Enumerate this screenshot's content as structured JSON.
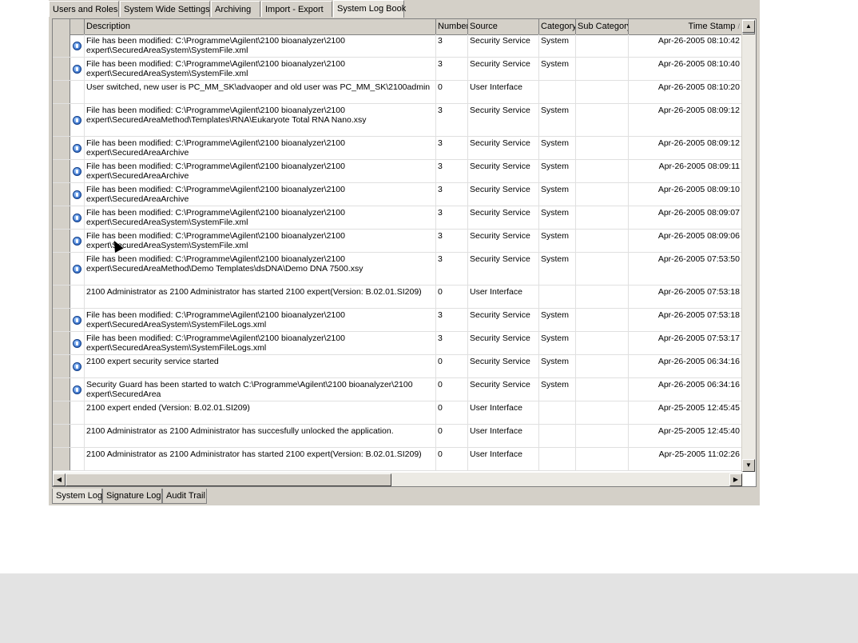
{
  "top_tabs": [
    "Users and Roles",
    "System Wide Settings",
    "Archiving",
    "Import - Export",
    "System Log Book"
  ],
  "active_top_tab": "System Log Book",
  "columns": {
    "description": "Description",
    "number": "Number",
    "source": "Source",
    "category": "Category",
    "sub_category": "Sub Category",
    "time_stamp": "Time Stamp",
    "sort_indicator": "/"
  },
  "rows": [
    {
      "desc": "File has been modified: C:\\Programme\\Agilent\\2100 bioanalyzer\\2100\nexpert\\SecuredAreaSystem\\SystemFile.xml",
      "num": "3",
      "src": "Security Service",
      "cat": "System",
      "sub": "",
      "ts": "Apr-26-2005 08:10:42",
      "icon": true
    },
    {
      "desc": "File has been modified: C:\\Programme\\Agilent\\2100 bioanalyzer\\2100\nexpert\\SecuredAreaSystem\\SystemFile.xml",
      "num": "3",
      "src": "Security Service",
      "cat": "System",
      "sub": "",
      "ts": "Apr-26-2005 08:10:40",
      "icon": true
    },
    {
      "desc": "User switched, new user is PC_MM_SK\\advaoper and old user was PC_MM_SK\\2100admin",
      "num": "0",
      "src": "User Interface",
      "cat": "",
      "sub": "",
      "ts": "Apr-26-2005 08:10:20",
      "icon": false
    },
    {
      "desc": "File has been modified: C:\\Programme\\Agilent\\2100 bioanalyzer\\2100\nexpert\\SecuredAreaMethod\\Templates\\RNA\\Eukaryote Total RNA Nano.xsy",
      "num": "3",
      "src": "Security Service",
      "cat": "System",
      "sub": "",
      "ts": "Apr-26-2005 08:09:12",
      "icon": true
    },
    {
      "desc": "File has been modified: C:\\Programme\\Agilent\\2100 bioanalyzer\\2100\nexpert\\SecuredAreaArchive",
      "num": "3",
      "src": "Security Service",
      "cat": "System",
      "sub": "",
      "ts": "Apr-26-2005 08:09:12",
      "icon": true
    },
    {
      "desc": "File has been modified: C:\\Programme\\Agilent\\2100 bioanalyzer\\2100\nexpert\\SecuredAreaArchive",
      "num": "3",
      "src": "Security Service",
      "cat": "System",
      "sub": "",
      "ts": "Apr-26-2005 08:09:11",
      "icon": true
    },
    {
      "desc": "File has been modified: C:\\Programme\\Agilent\\2100 bioanalyzer\\2100\nexpert\\SecuredAreaArchive",
      "num": "3",
      "src": "Security Service",
      "cat": "System",
      "sub": "",
      "ts": "Apr-26-2005 08:09:10",
      "icon": true
    },
    {
      "desc": "File has been modified: C:\\Programme\\Agilent\\2100 bioanalyzer\\2100\nexpert\\SecuredAreaSystem\\SystemFile.xml",
      "num": "3",
      "src": "Security Service",
      "cat": "System",
      "sub": "",
      "ts": "Apr-26-2005 08:09:07",
      "icon": true
    },
    {
      "desc": "File has been modified: C:\\Programme\\Agilent\\2100 bioanalyzer\\2100\nexpert\\SecuredAreaSystem\\SystemFile.xml",
      "num": "3",
      "src": "Security Service",
      "cat": "System",
      "sub": "",
      "ts": "Apr-26-2005 08:09:06",
      "icon": true
    },
    {
      "desc": "File has been modified: C:\\Programme\\Agilent\\2100 bioanalyzer\\2100\nexpert\\SecuredAreaMethod\\Demo Templates\\dsDNA\\Demo DNA 7500.xsy",
      "num": "3",
      "src": "Security Service",
      "cat": "System",
      "sub": "",
      "ts": "Apr-26-2005 07:53:50",
      "icon": true
    },
    {
      "desc": "2100 Administrator as 2100 Administrator has started 2100 expert(Version: B.02.01.SI209)",
      "num": "0",
      "src": "User Interface",
      "cat": "",
      "sub": "",
      "ts": "Apr-26-2005 07:53:18",
      "icon": false
    },
    {
      "desc": "File has been modified: C:\\Programme\\Agilent\\2100 bioanalyzer\\2100\nexpert\\SecuredAreaSystem\\SystemFileLogs.xml",
      "num": "3",
      "src": "Security Service",
      "cat": "System",
      "sub": "",
      "ts": "Apr-26-2005 07:53:18",
      "icon": true
    },
    {
      "desc": "File has been modified: C:\\Programme\\Agilent\\2100 bioanalyzer\\2100\nexpert\\SecuredAreaSystem\\SystemFileLogs.xml",
      "num": "3",
      "src": "Security Service",
      "cat": "System",
      "sub": "",
      "ts": "Apr-26-2005 07:53:17",
      "icon": true
    },
    {
      "desc": "2100 expert security service started",
      "num": "0",
      "src": "Security Service",
      "cat": "System",
      "sub": "",
      "ts": "Apr-26-2005 06:34:16",
      "icon": true
    },
    {
      "desc": "Security Guard has been started to watch C:\\Programme\\Agilent\\2100 bioanalyzer\\2100\nexpert\\SecuredArea",
      "num": "0",
      "src": "Security Service",
      "cat": "System",
      "sub": "",
      "ts": "Apr-26-2005 06:34:16",
      "icon": true
    },
    {
      "desc": "2100 expert ended (Version: B.02.01.SI209)",
      "num": "0",
      "src": "User Interface",
      "cat": "",
      "sub": "",
      "ts": "Apr-25-2005 12:45:45",
      "icon": false
    },
    {
      "desc": "2100 Administrator as 2100 Administrator has succesfully unlocked the application.",
      "num": "0",
      "src": "User Interface",
      "cat": "",
      "sub": "",
      "ts": "Apr-25-2005 12:45:40",
      "icon": false
    },
    {
      "desc": "2100 Administrator as 2100 Administrator has started 2100 expert(Version: B.02.01.SI209)",
      "num": "0",
      "src": "User Interface",
      "cat": "",
      "sub": "",
      "ts": "Apr-25-2005 11:02:26",
      "icon": false
    }
  ],
  "bottom_tabs": [
    "System Log",
    "Signature Log",
    "Audit Trail"
  ],
  "active_bottom_tab": "System Log",
  "icons": {
    "info": "info-icon",
    "scroll_up": "scroll-up-icon",
    "scroll_down": "scroll-down-icon",
    "scroll_left": "scroll-left-icon",
    "scroll_right": "scroll-right-icon"
  }
}
